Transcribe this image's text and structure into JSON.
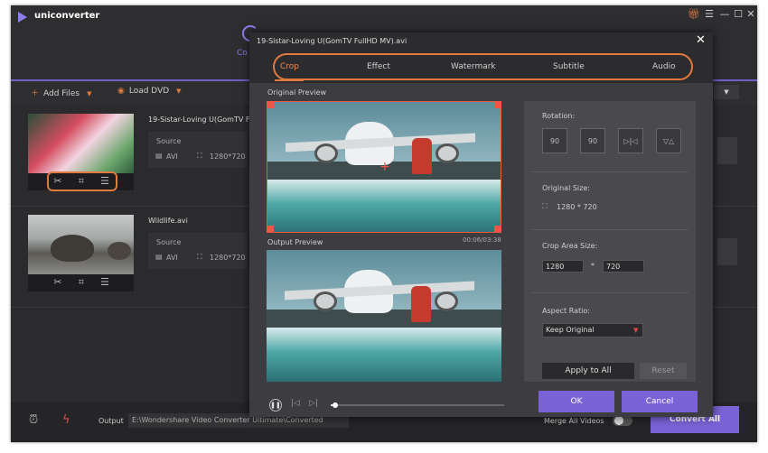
{
  "app": {
    "name": "uniconverter",
    "tab_partial": "Co"
  },
  "toolbar": {
    "add_files": "Add Files",
    "load_dvd": "Load DVD"
  },
  "files": [
    {
      "name": "19-Sistar-Loving U(GomTV Full",
      "source_label": "Source",
      "format": "AVI",
      "resolution": "1280*720"
    },
    {
      "name": "Wildlife.avi",
      "source_label": "Source",
      "format": "AVI",
      "resolution": "1280*720"
    }
  ],
  "bottom": {
    "output_label": "Output",
    "output_path": "E:\\Wondershare Video Converter Ultimate\\Converted",
    "merge_label": "Merge All Videos",
    "convert_label": "Convert All"
  },
  "dialog": {
    "title": "19-Sistar-Loving U(GomTV FullHD MV).avi",
    "tabs": [
      "Crop",
      "Effect",
      "Watermark",
      "Subtitle",
      "Audio"
    ],
    "active_tab": "Crop",
    "original_preview_label": "Original Preview",
    "output_preview_label": "Output Preview",
    "time": "00:06/03:38",
    "rotation_label": "Rotation:",
    "rotate_left_label": "90",
    "rotate_right_label": "90",
    "original_size_label": "Original Size:",
    "original_size_value": "1280 * 720",
    "crop_area_label": "Crop Area Size:",
    "crop_width": "1280",
    "crop_times": "*",
    "crop_height": "720",
    "aspect_ratio_label": "Aspect Ratio:",
    "aspect_ratio_value": "Keep Original",
    "apply_to_all": "Apply to All",
    "reset": "Reset",
    "ok": "OK",
    "cancel": "Cancel",
    "progress": 0.02
  },
  "colors": {
    "accent_purple": "#7a63d6",
    "accent_orange": "#e07a3f"
  }
}
